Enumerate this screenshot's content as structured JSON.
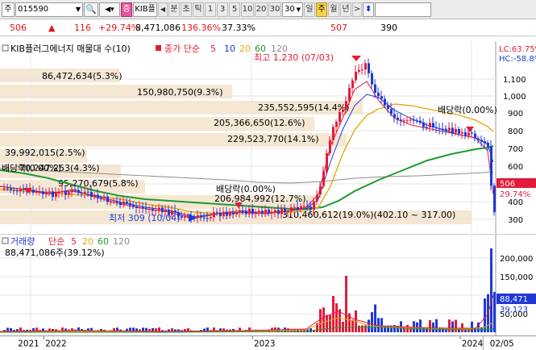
{
  "toolbar": {
    "market_label": "주",
    "code": "015590",
    "name_short": "KIB플",
    "arrow_left": "◀",
    "periods": [
      "분",
      "초",
      "틱",
      "1",
      "3",
      "5",
      "10",
      "20",
      "30",
      "30"
    ],
    "period_select": "30",
    "units": [
      "일",
      "주",
      "월",
      "년"
    ],
    "nav_right": ">",
    "updown": "⬍",
    "red_badge": "증"
  },
  "quote": {
    "price": "506",
    "direction": "▲",
    "change": "116",
    "change_pct": "+29.74%",
    "volume": "8,471,086",
    "volume_ratio": "136.36%",
    "turnover_pct": "37.33%",
    "prev_high": "507",
    "prev_low": "390"
  },
  "price_panel": {
    "legend_title": "KIB플러그에너지 매물대 수(10)",
    "ma_label": "종가 단순",
    "ma_periods": [
      "5",
      "10",
      "20",
      "60",
      "120"
    ],
    "ma_colors": [
      "#E31B3A",
      "#1F38D6",
      "#E5A90C",
      "#1D9B2C",
      "#8C8C8C"
    ],
    "lc_label": "LC:63.75%",
    "hc_label": "HC:-58.8%",
    "y_ticks": [
      "1,100",
      "1,000",
      "900",
      "800",
      "700",
      "600",
      "500",
      "400",
      "300"
    ],
    "current_price_tag": "506",
    "current_pct_tag": "29.74%",
    "high_annotation": "최고 1,230 (07/03)",
    "low_annotation": "최저 309 (10/04)",
    "dividend_annotations": [
      "배당락(0.00%)",
      "배당락(0.00%)",
      "배당락(0.00%)"
    ],
    "volume_profile": [
      {
        "label": "86,472,634(5.3%)"
      },
      {
        "label": "150,980,750(9.3%)"
      },
      {
        "label": "235,552,595(14.4%)"
      },
      {
        "label": "205,366,650(12.6%)"
      },
      {
        "label": "229,523,770(14.1%)"
      },
      {
        "label": "39,992,015(2.5%)"
      },
      {
        "label": "70,247,253(4.3%)"
      },
      {
        "label": "95,270,679(5.8%)"
      },
      {
        "label": "206,984,992(12.7%)"
      },
      {
        "label": "310,460,612(19.0%)(402.10 ~ 317.00)"
      }
    ]
  },
  "volume_panel": {
    "legend_title": "거래량",
    "ma_label": "단순",
    "ma_periods": [
      "5",
      "20",
      "60",
      "120"
    ],
    "ma_colors": [
      "#E31B3A",
      "#E5A90C",
      "#1D9B2C",
      "#8C8C8C"
    ],
    "volume_value": "88,471,086주(39.12%)",
    "y_ticks": [
      "200,000",
      "150,000",
      "100,000",
      "50,000"
    ],
    "current_tag": "88,471",
    "current_tag2": "39,123"
  },
  "date_axis": {
    "labels": [
      "2021",
      "2022",
      "2023",
      "2024",
      "02/05"
    ]
  }
}
